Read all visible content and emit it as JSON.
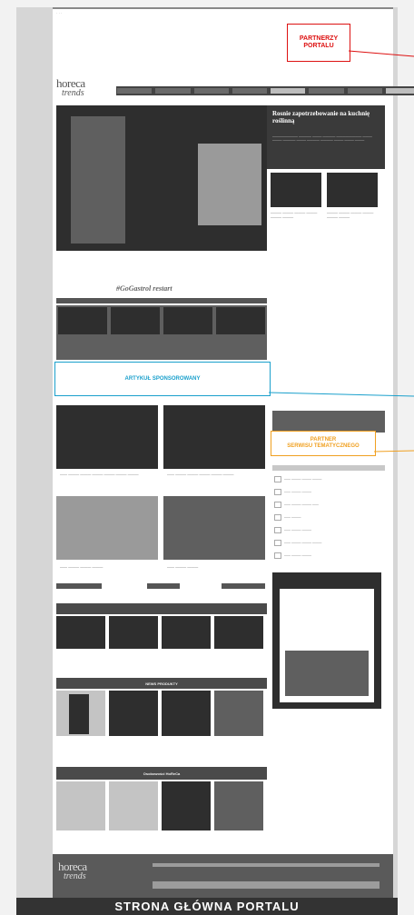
{
  "callouts": {
    "partners": "PARTNERZY\nPORTALU",
    "sponsored": "ARTYKUŁ SPONSOROWANY",
    "thematic": "PARTNER\nSERWISU TEMATYCZNEGO"
  },
  "logo": {
    "line1": "horeca",
    "line2": "trends"
  },
  "hero": {
    "title": "Rosnie zapotrzebowanie na kuchnię roślinną"
  },
  "gogastro": "#GoGastrol restart",
  "sections": {
    "news": "NEWS PRODUKTY",
    "interviews": "Osobowości HoReCa"
  },
  "caption": "STRONA GŁÓWNA PORTALU",
  "colors": {
    "red": "#d11111",
    "blue": "#1aa0cc",
    "orange": "#f0a020"
  }
}
